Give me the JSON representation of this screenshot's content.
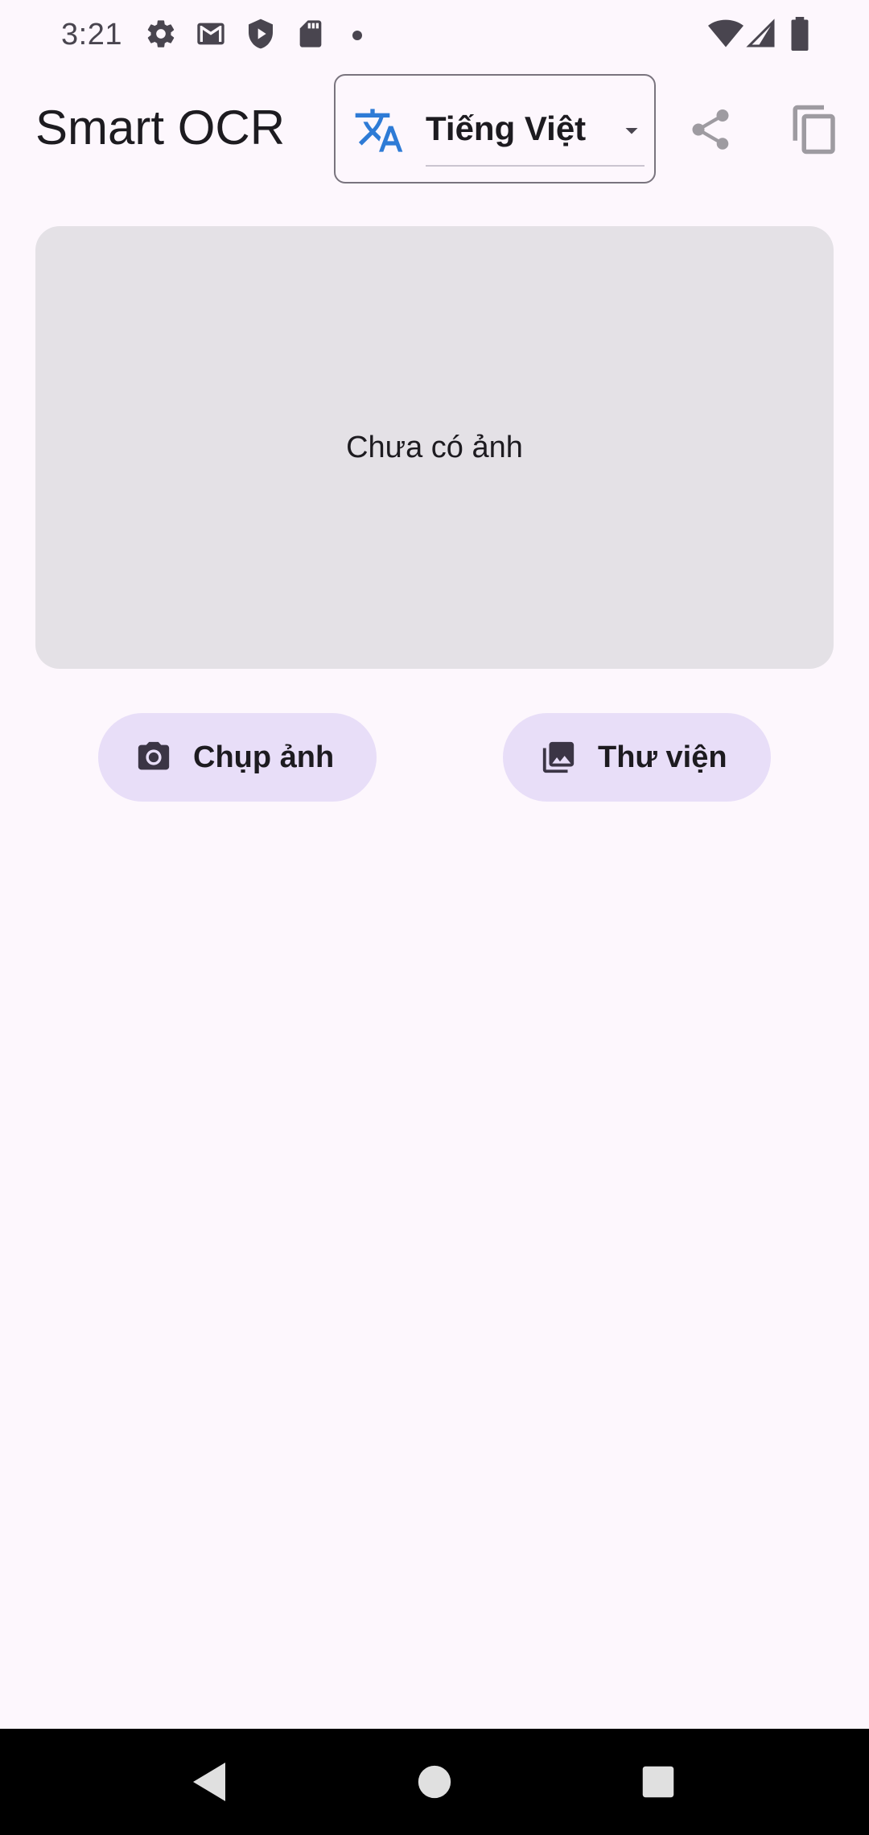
{
  "status_bar": {
    "time": "3:21",
    "left_icons": [
      "settings-icon",
      "gmail-icon",
      "shield-icon",
      "sd-card-icon",
      "notification-dot-icon"
    ],
    "right_icons": [
      "wifi-icon",
      "cell-signal-icon",
      "battery-icon"
    ]
  },
  "app_bar": {
    "title": "Smart OCR",
    "language_selector": {
      "selected": "Tiếng Việt",
      "icon": "translate-icon",
      "accent_color": "#2e7bd6"
    },
    "actions": [
      "share-icon",
      "copy-icon"
    ]
  },
  "main": {
    "image_placeholder_text": "Chưa có ảnh",
    "buttons": {
      "camera": {
        "label": "Chụp ảnh",
        "icon": "camera-icon"
      },
      "gallery": {
        "label": "Thư viện",
        "icon": "photo-library-icon"
      }
    }
  },
  "nav_bar": {
    "buttons": [
      "back-icon",
      "home-icon",
      "recents-icon"
    ]
  },
  "colors": {
    "background": "#fdf7fd",
    "placeholder": "#e4e1e6",
    "tonal_button": "#e8def8",
    "outline": "#79747e"
  }
}
